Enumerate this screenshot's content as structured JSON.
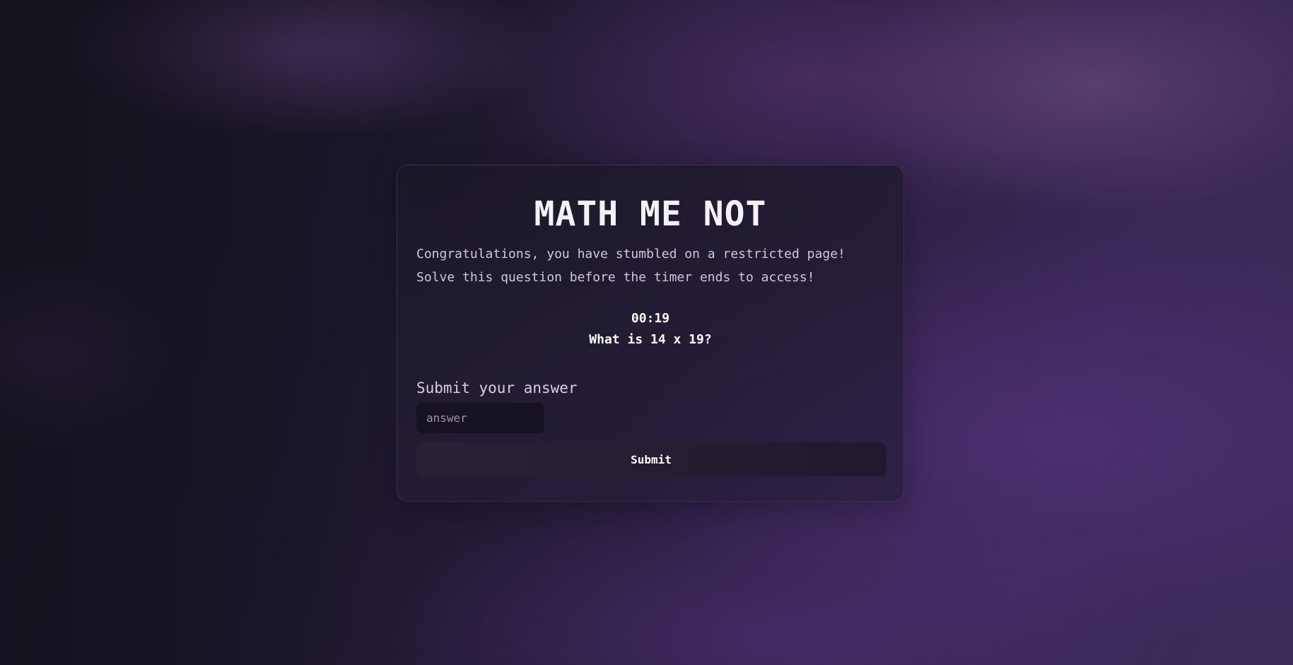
{
  "page": {
    "title": "MATH ME NOT",
    "intro_line_1": "Congratulations, you have stumbled on a restricted page!",
    "intro_line_2": "Solve this question before the timer ends to access!"
  },
  "challenge": {
    "timer": "00:19",
    "question": "What is 14 x 19?"
  },
  "form": {
    "label": "Submit your answer",
    "answer_placeholder": "answer",
    "answer_value": "",
    "submit_label": "Submit"
  },
  "colors": {
    "background": "#1b1729",
    "accent_purple": "#3b2a5a",
    "card": "#1c1828",
    "text": "#ffffff",
    "muted_text": "#cfc8dc"
  }
}
